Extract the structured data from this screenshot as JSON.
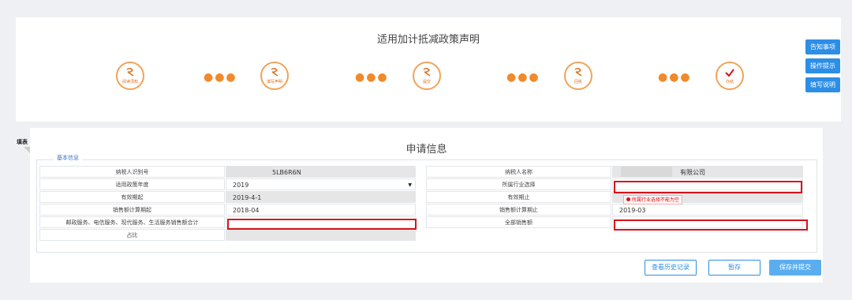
{
  "top": {
    "title": "适用加计抵减政策声明",
    "steps": [
      {
        "label": "阅读须知"
      },
      {
        "label": "填写声明"
      },
      {
        "label": "提交"
      },
      {
        "label": "回执"
      },
      {
        "label": "办结"
      }
    ],
    "dots": "●●●"
  },
  "side_buttons": [
    "告知事项",
    "操作提示",
    "填写说明"
  ],
  "tab_label": "填表",
  "form": {
    "title": "申请信息",
    "legend": "基本信息",
    "rows": [
      {
        "left_label": "纳税人识别号",
        "left_value": "5LB6R6N",
        "right_label": "纳税人名称",
        "right_value": "有限公司"
      },
      {
        "left_label": "适用政策年度",
        "left_value": "2019",
        "right_label": "所属行业选择",
        "right_value": ""
      },
      {
        "left_label": "有效期起",
        "left_value": "2019-4-1",
        "right_label": "有效期止",
        "right_value": ""
      },
      {
        "left_label": "销售额计算期起",
        "left_value": "2018-04",
        "right_label": "销售额计算期止",
        "right_value": "2019-03"
      },
      {
        "left_label": "邮政服务、电信服务、现代服务、生活服务销售额合计",
        "left_value": "",
        "right_label": "全部销售额",
        "right_value": ""
      },
      {
        "left_label": "占比",
        "left_value": ""
      }
    ],
    "select_arrow": "▼",
    "error_tip": "所属行业选择不能为空"
  },
  "buttons": {
    "history": "查看历史记录",
    "save": "暂存",
    "submit": "保存并提交"
  },
  "colors": {
    "accent": "#2d8ee6",
    "step_orange": "#f0a35a",
    "error_red": "#d7131a"
  }
}
